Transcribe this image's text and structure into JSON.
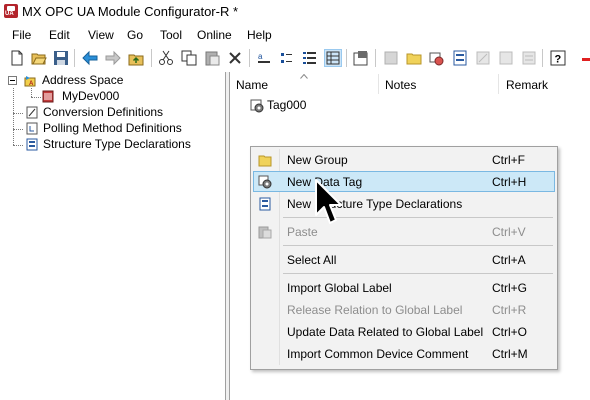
{
  "window": {
    "title": "MX OPC UA Module Configurator-R *"
  },
  "menubar": {
    "items": [
      "File",
      "Edit",
      "View",
      "Go",
      "Tool",
      "Online",
      "Help"
    ]
  },
  "tree": {
    "root": "Address Space",
    "device": "MyDev000",
    "conversion": "Conversion Definitions",
    "polling": "Polling Method Definitions",
    "structure": "Structure Type Declarations"
  },
  "list": {
    "columns": {
      "name": "Name",
      "notes": "Notes",
      "remark": "Remark"
    },
    "rows": [
      {
        "name": "Tag000"
      }
    ]
  },
  "context_menu": {
    "items": [
      {
        "label": "New Group",
        "shortcut": "Ctrl+F",
        "icon": "folder-icon",
        "enabled": true
      },
      {
        "label": "New Data Tag",
        "shortcut": "Ctrl+H",
        "icon": "data-tag-icon",
        "enabled": true,
        "highlighted": true
      },
      {
        "label": "New Structure Type Declarations",
        "shortcut": "",
        "icon": "structure-icon",
        "enabled": true
      },
      {
        "label": "Paste",
        "shortcut": "Ctrl+V",
        "icon": "paste-icon",
        "enabled": false
      },
      {
        "label": "Select All",
        "shortcut": "Ctrl+A",
        "enabled": true
      },
      {
        "label": "Import Global Label",
        "shortcut": "Ctrl+G",
        "enabled": true
      },
      {
        "label": "Release Relation to Global Label",
        "shortcut": "Ctrl+R",
        "enabled": false
      },
      {
        "label": "Update Data Related to Global Label",
        "shortcut": "Ctrl+O",
        "enabled": true
      },
      {
        "label": "Import Common Device Comment",
        "shortcut": "Ctrl+M",
        "enabled": true
      }
    ]
  },
  "colors": {
    "highlight": "#cce8f7",
    "highlight_border": "#7ab8e2",
    "disabled_text": "#8d8d8d"
  }
}
